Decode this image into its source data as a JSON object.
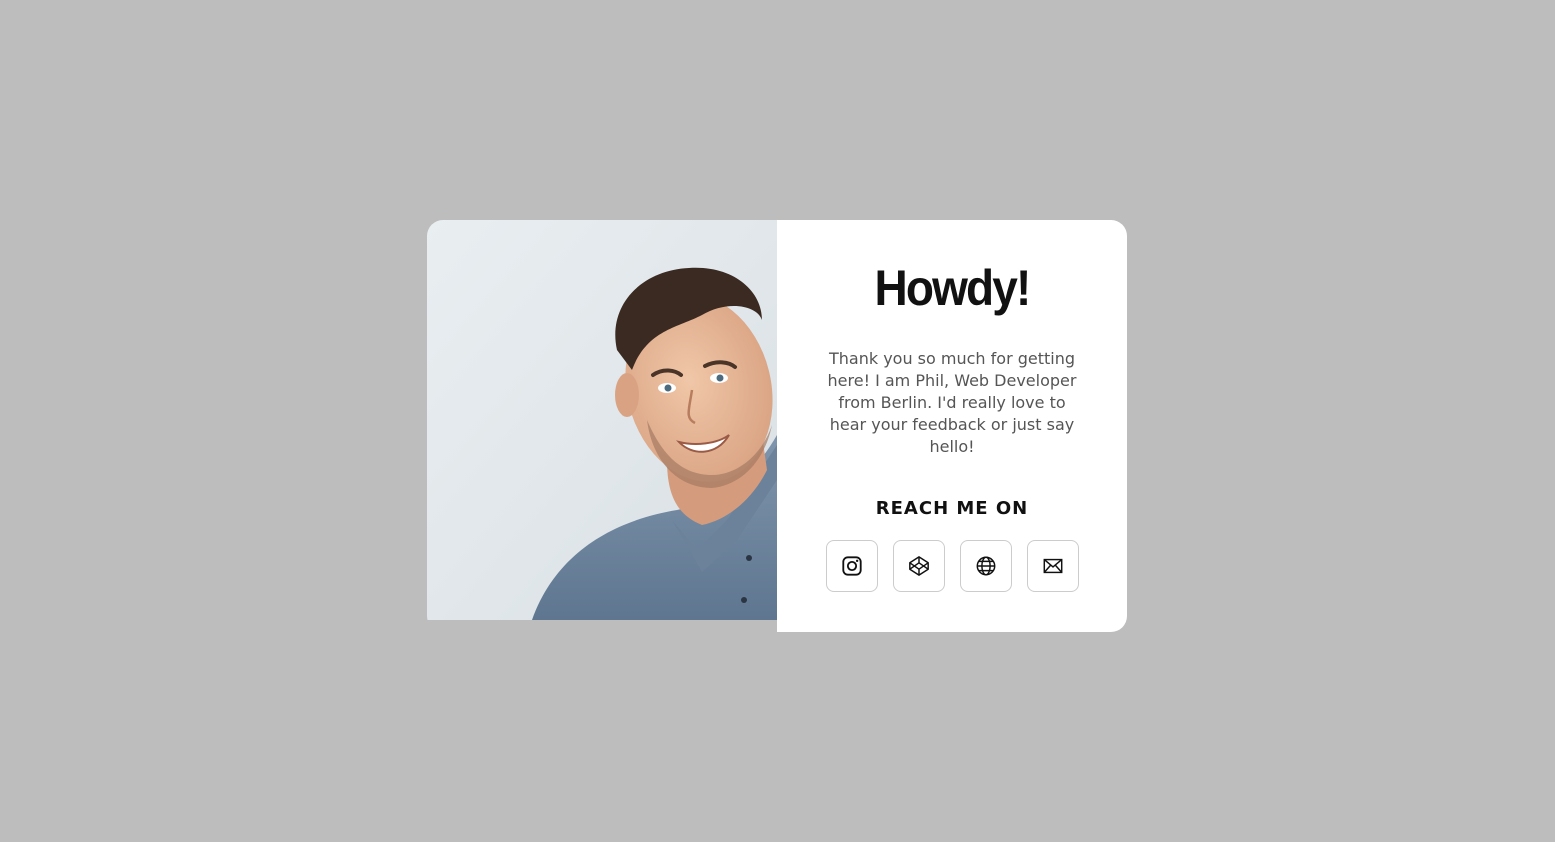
{
  "card": {
    "title": "Howdy!",
    "text": "Thank you so much for getting here! I am Phil, Web Developer from Berlin. I'd really love to hear your feedback or just say hello!",
    "reach_label": "REACH ME ON"
  },
  "social": [
    {
      "icon": "instagram-icon"
    },
    {
      "icon": "codepen-icon"
    },
    {
      "icon": "globe-icon"
    },
    {
      "icon": "mail-icon"
    }
  ],
  "colors": {
    "background": "#bdbdbd",
    "card": "#ffffff",
    "title": "#111111",
    "body_text": "#555555"
  }
}
